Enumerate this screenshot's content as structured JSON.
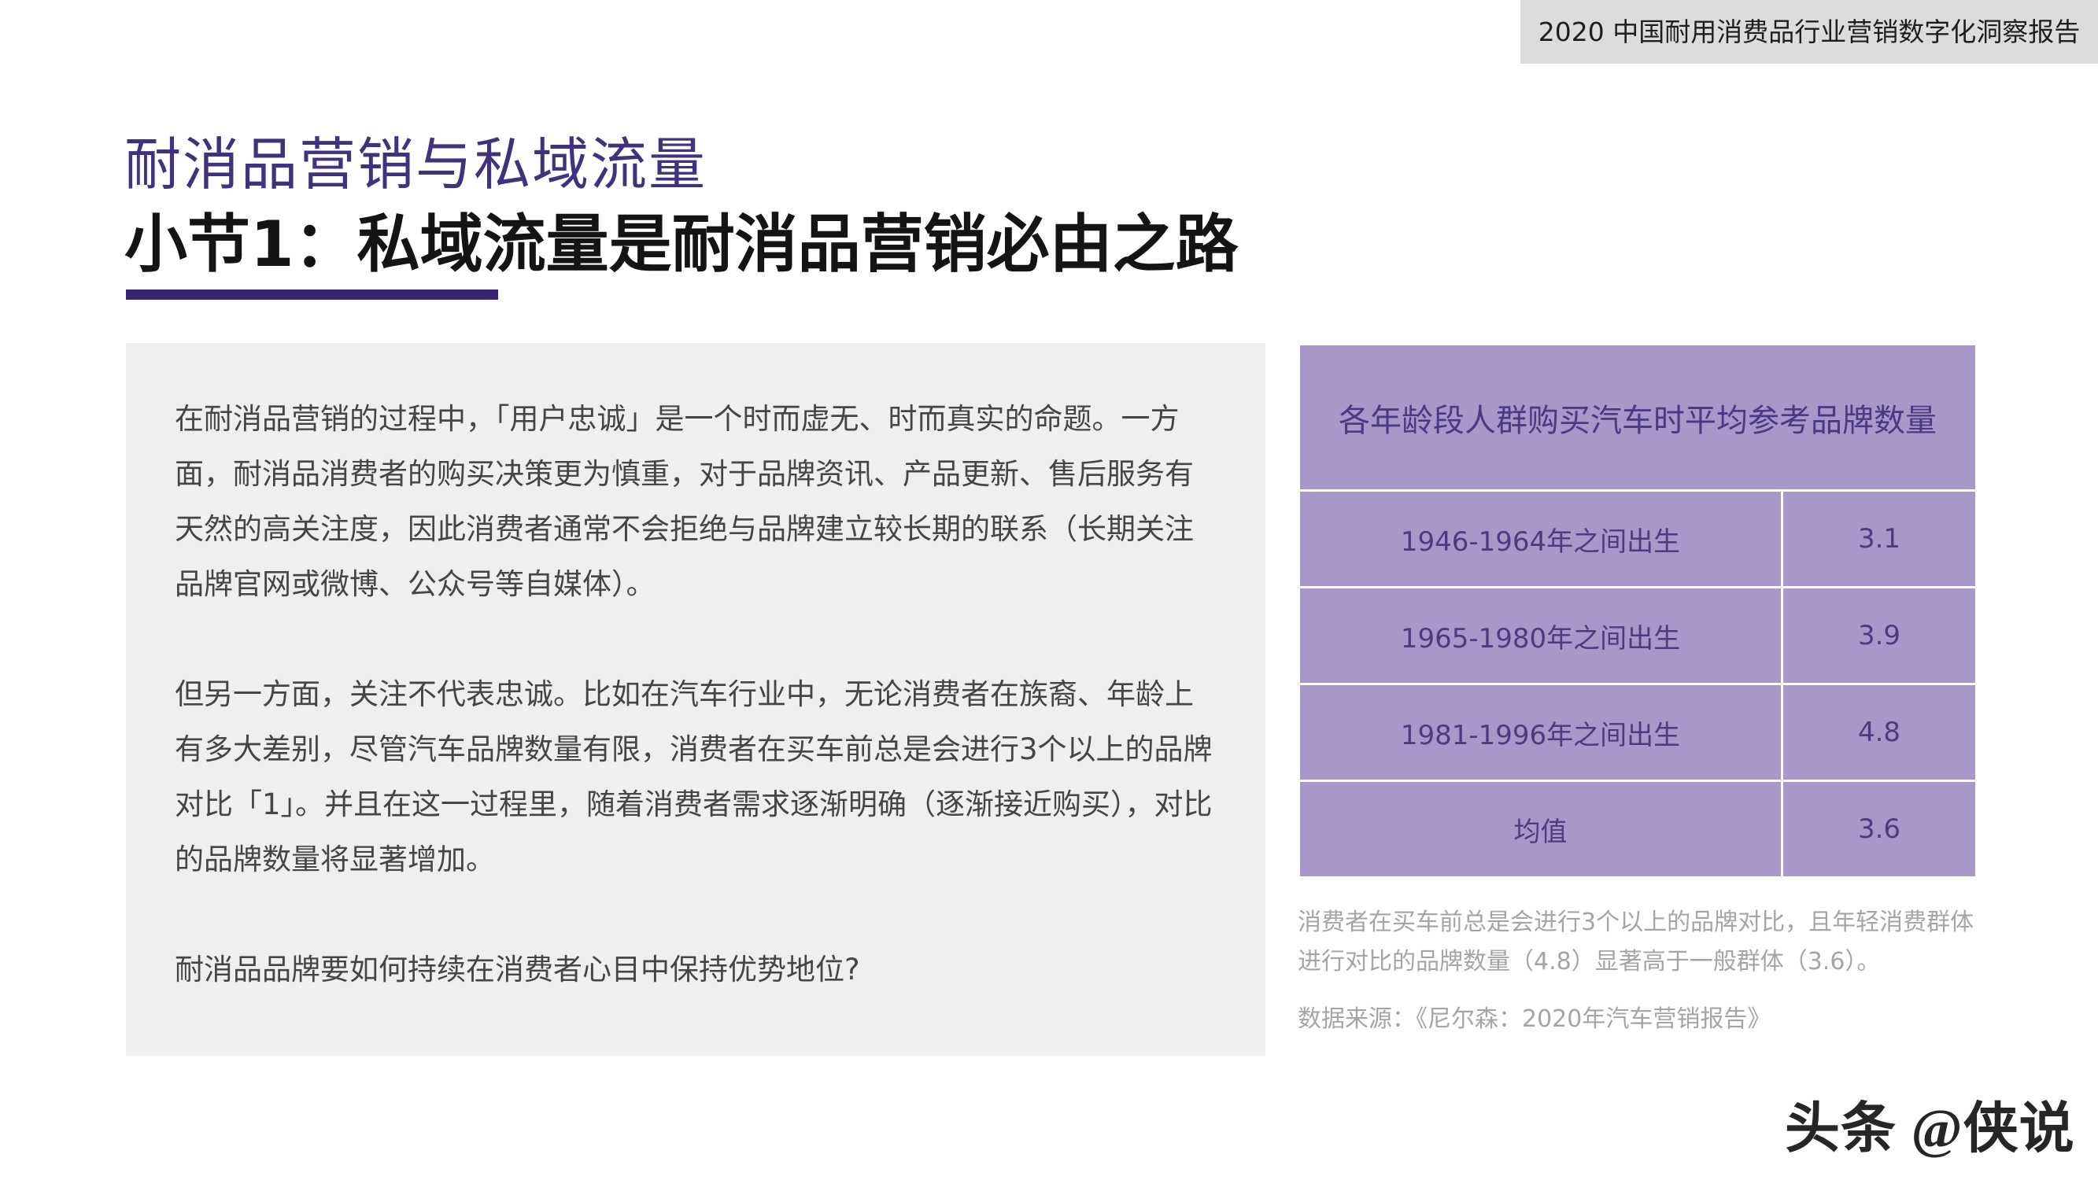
{
  "header": {
    "report_tag": "2020 中国耐用消费品行业营销数字化洞察报告"
  },
  "title": {
    "section": "耐消品营销与私域流量",
    "subsection": "小节1：私域流量是耐消品营销必由之路"
  },
  "body": {
    "paragraphs": [
      "在耐消品营销的过程中，「用户忠诚」是一个时而虚无、时而真实的命题。一方面，耐消品消费者的购买决策更为慎重，对于品牌资讯、产品更新、售后服务有天然的高关注度，因此消费者通常不会拒绝与品牌建立较长期的联系（长期关注品牌官网或微博、公众号等自媒体）。",
      "但另一方面，关注不代表忠诚。比如在汽车行业中，无论消费者在族裔、年龄上有多大差别，尽管汽车品牌数量有限，消费者在买车前总是会进行3个以上的品牌对比「1」。并且在这一过程里，随着消费者需求逐渐明确（逐渐接近购买），对比的品牌数量将显著增加。",
      "耐消品品牌要如何持续在消费者心目中保持优势地位?"
    ]
  },
  "table": {
    "title": "各年龄段人群购买汽车时平均参考品牌数量",
    "rows": [
      {
        "label": "1946-1964年之间出生",
        "value": "3.1"
      },
      {
        "label": "1965-1980年之间出生",
        "value": "3.9"
      },
      {
        "label": "1981-1996年之间出生",
        "value": "4.8"
      },
      {
        "label": "均值",
        "value": "3.6"
      }
    ],
    "caption": "消费者在买车前总是会进行3个以上的品牌对比，且年轻消费群体进行对比的品牌数量（4.8）显著高于一般群体（3.6）。",
    "source": "数据来源：《尼尔森：2020年汽车营销报告》"
  },
  "watermark": "头条 @侠说",
  "colors": {
    "accent": "#41317e",
    "table_fill": "#a898c9",
    "panel_bg": "#efefef"
  }
}
